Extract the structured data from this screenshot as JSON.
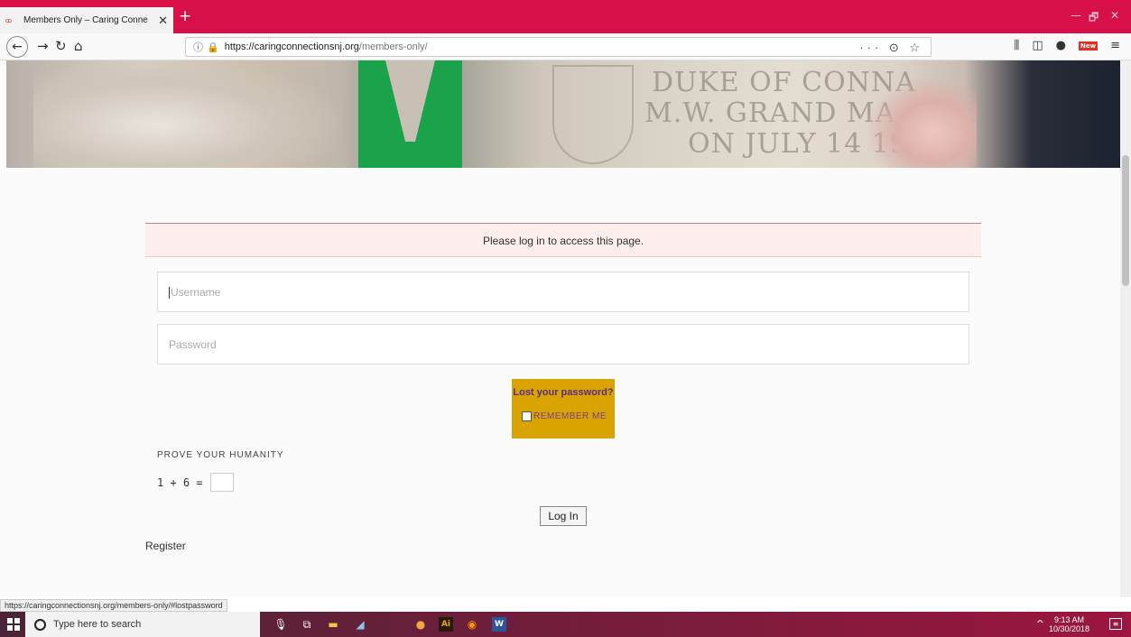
{
  "browser": {
    "tab_title": "Members Only – Caring Conne",
    "tab_close": "✕",
    "new_tab": "+",
    "url_host": "https://caringconnectionsnj.org",
    "url_path": "/members-only/",
    "url_actions": "··· ⊙ ☆",
    "new_badge": "New",
    "win_min": "—",
    "win_max": "🗗",
    "win_close": "✕"
  },
  "banner": {
    "engraving_line1": "DUKE OF CONNA",
    "engraving_line2": "M.W. GRAND MA",
    "engraving_line3": "ON JULY 14 19"
  },
  "page": {
    "notice": "Please log in to access this page.",
    "username_placeholder": "Username",
    "password_placeholder": "Password",
    "lost_password": "Lost your password?",
    "remember_me": "REMEMBER ME",
    "prove_humanity": "PROVE YOUR HUMANITY",
    "math_question": "1 + 6 =",
    "login_button": "Log In",
    "register_link": "Register"
  },
  "status_bar": {
    "hover_url": "https://caringconnectionsnj.org/members-only/#lostpassword"
  },
  "taskbar": {
    "search_placeholder": "Type here to search",
    "time": "9:13 AM",
    "date": "10/30/2018"
  }
}
